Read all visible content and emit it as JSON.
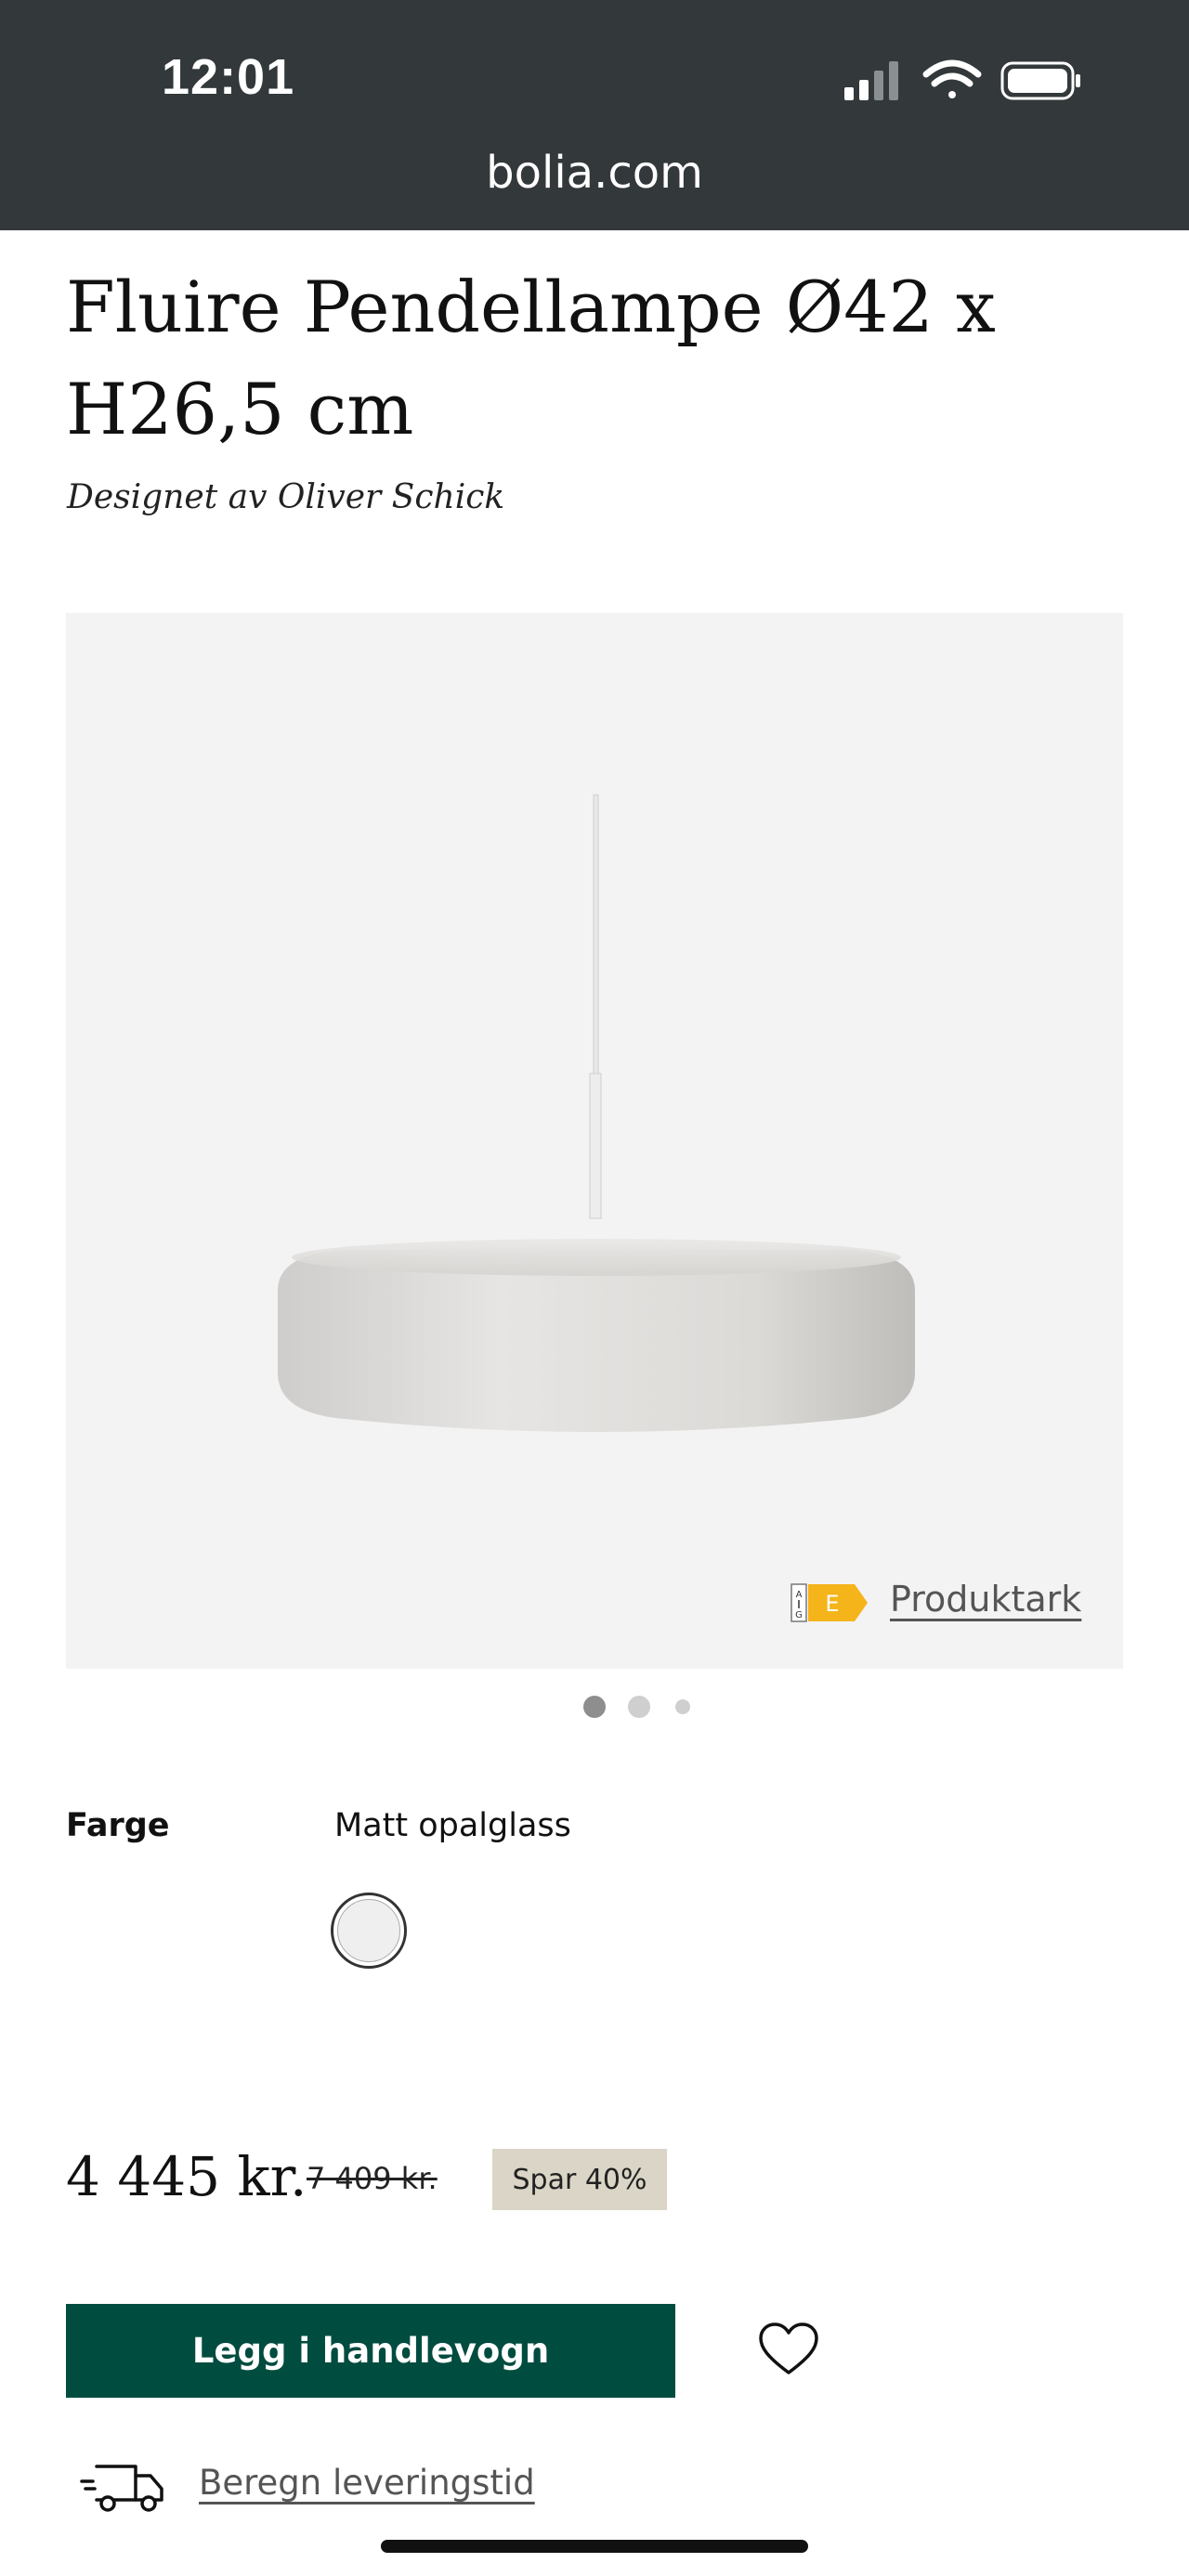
{
  "status_bar": {
    "time": "12:01",
    "url": "bolia.com",
    "icons": [
      "signal-icon",
      "wifi-icon",
      "battery-icon"
    ]
  },
  "product": {
    "title": "Fluire Pendellampe Ø42 x H26,5 cm",
    "designer": "Designet av Oliver Schick",
    "energy_label": "E",
    "product_sheet_link": "Produktark",
    "gallery": {
      "total_images": 3,
      "active_index": 0
    }
  },
  "color_option": {
    "label": "Farge",
    "selected": "Matt opalglass"
  },
  "pricing": {
    "price": "4 445 kr.",
    "old_price": "7 409 kr.",
    "badge": "Spar 40%"
  },
  "actions": {
    "add_to_cart": "Legg i handlevogn",
    "delivery_link": "Beregn leveringstid"
  },
  "colors": {
    "status_bar_bg": "#33383b",
    "cart_button_bg": "#004c3f",
    "badge_bg": "#dad5c6",
    "image_panel_bg": "#f3f3f3",
    "energy_label_color": "#f4b41a"
  }
}
